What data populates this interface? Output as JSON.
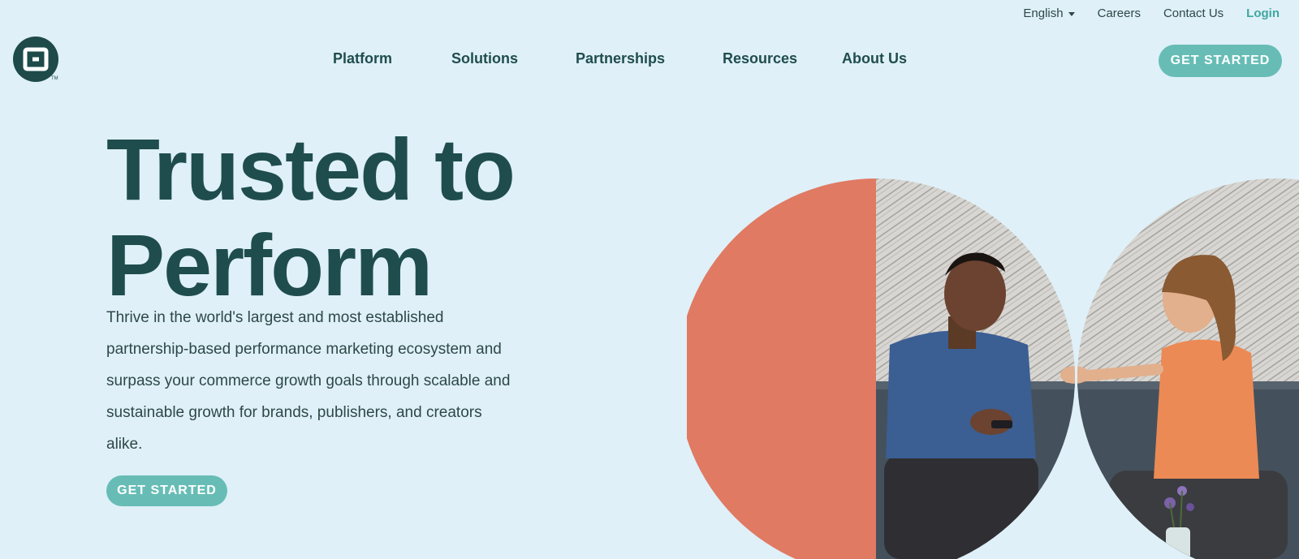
{
  "utility_nav": {
    "language": "English",
    "careers": "Careers",
    "contact": "Contact Us",
    "login": "Login"
  },
  "logo": {
    "tm": "TM"
  },
  "nav": {
    "items": [
      "Platform",
      "Solutions",
      "Partnerships",
      "Resources",
      "About Us"
    ]
  },
  "header_cta": "GET STARTED",
  "hero": {
    "title_line1": "Trusted to",
    "title_line2": "Perform",
    "description": "Thrive in the world's largest and most established partnership-based performance marketing ecosystem and surpass your commerce growth goals through scalable and sustainable growth for brands, publishers, and creators alike.",
    "cta": "GET STARTED"
  },
  "colors": {
    "background": "#dff0f8",
    "brand_dark": "#1f4d4d",
    "accent_teal": "#67bdb6",
    "coral": "#e07a63"
  }
}
